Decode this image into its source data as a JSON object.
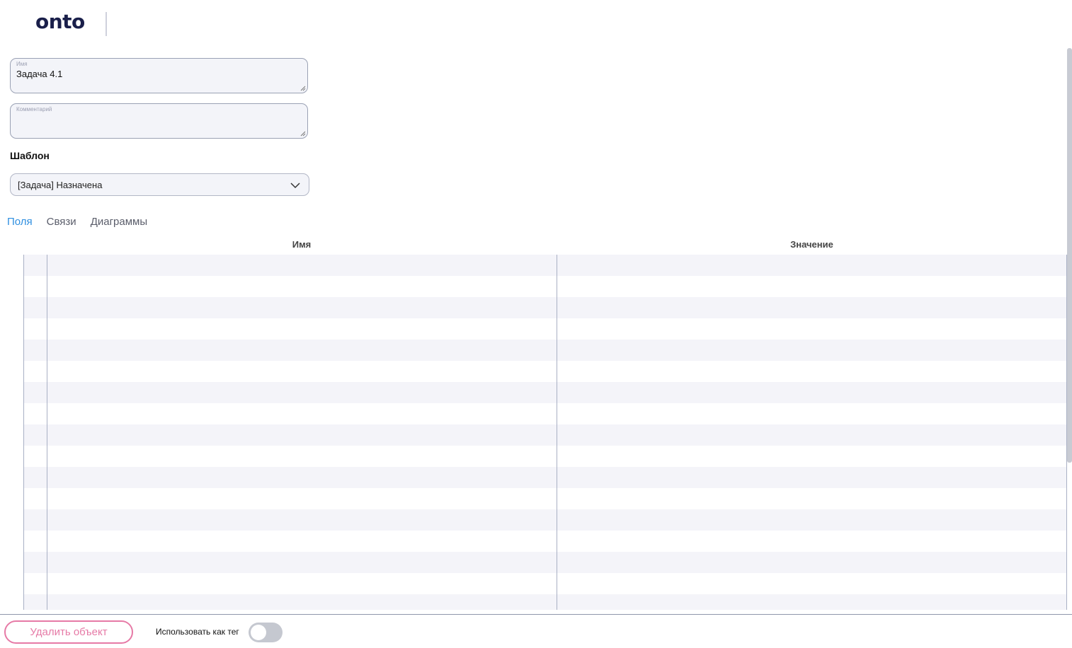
{
  "header": {
    "logo_text": "onto"
  },
  "form": {
    "name_field": {
      "label": "Имя",
      "value": "Задача 4.1"
    },
    "comment_field": {
      "label": "Комментарий",
      "value": ""
    },
    "template_label": "Шаблон",
    "template_select": {
      "value": "[Задача] Назначена"
    }
  },
  "tabs": [
    {
      "label": "Поля",
      "active": true
    },
    {
      "label": "Связи",
      "active": false
    },
    {
      "label": "Диаграммы",
      "active": false
    }
  ],
  "table": {
    "columns": [
      "Имя",
      "Значение"
    ],
    "rows": []
  },
  "footer": {
    "delete_label": "Удалить объект",
    "tag_label": "Использовать как тег",
    "tag_toggle_on": false
  },
  "colors": {
    "accent_tab": "#2f8fe0",
    "delete_pink": "#e67aa6",
    "logo": "#1a1f4a"
  },
  "icons": {
    "select_chevron": "chevron-down-icon"
  }
}
